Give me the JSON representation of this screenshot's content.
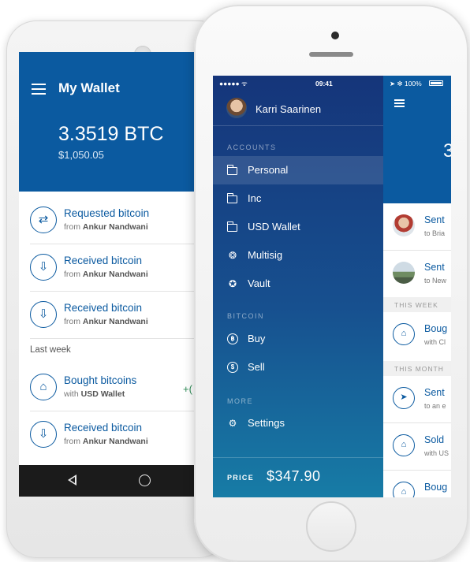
{
  "android": {
    "header": {
      "title": "My Wallet",
      "balance_btc": "3.3519 BTC",
      "balance_usd": "$1,050.05"
    },
    "transactions": [
      {
        "title": "Requested bitcoin",
        "prefix": "from",
        "party": "Ankur Nandwani",
        "icon": "exchange-arrows-icon",
        "glyph": "⇄"
      },
      {
        "title": "Received bitcoin",
        "prefix": "from",
        "party": "Ankur Nandwani",
        "icon": "receive-icon",
        "glyph": "⇩"
      },
      {
        "title": "Received bitcoin",
        "prefix": "from",
        "party": "Ankur Nandwani",
        "icon": "receive-icon",
        "glyph": "⇩"
      }
    ],
    "section_last_week": "Last week",
    "last_week": [
      {
        "title": "Bought bitcoins",
        "prefix": "with",
        "party": "USD Wallet",
        "amount": "+(",
        "icon": "bank-icon",
        "glyph": "⌂"
      },
      {
        "title": "Received bitcoin",
        "prefix": "from",
        "party": "Ankur Nandwani",
        "icon": "receive-icon",
        "glyph": "⇩"
      }
    ]
  },
  "iphone": {
    "status": {
      "carrier": "●●●●● ᯤ",
      "time": "09:41",
      "right": "➤ ✻ 100%"
    },
    "user": {
      "name": "Karri Saarinen"
    },
    "accounts_label": "ACCOUNTS",
    "accounts": [
      {
        "label": "Personal",
        "selected": true
      },
      {
        "label": "Inc",
        "selected": false
      },
      {
        "label": "USD Wallet",
        "selected": false
      },
      {
        "label": "Multisig",
        "selected": false,
        "icon": "multisig-icon",
        "glyph": "❂"
      },
      {
        "label": "Vault",
        "selected": false,
        "icon": "vault-icon",
        "glyph": "✪"
      }
    ],
    "bitcoin_label": "BITCOIN",
    "bitcoin_items": [
      {
        "label": "Buy",
        "glyph": "฿"
      },
      {
        "label": "Sell",
        "glyph": "$"
      }
    ],
    "more_label": "MORE",
    "settings_label": "Settings",
    "price_label": "PRICE",
    "price_value": "$347.90",
    "peek": {
      "balance_partial": "3",
      "rows": [
        {
          "title": "Sent",
          "sub": "to Bria"
        },
        {
          "title": "Sent",
          "sub": "to New"
        }
      ],
      "this_week": "THIS WEEK",
      "week_rows": [
        {
          "title": "Boug",
          "sub": "with Cl",
          "glyph": "⌂"
        }
      ],
      "this_month": "THIS MONTH",
      "month_rows": [
        {
          "title": "Sent",
          "sub": "to an e",
          "glyph": "➤"
        },
        {
          "title": "Sold",
          "sub": "with US",
          "glyph": "⌂"
        },
        {
          "title": "Boug",
          "sub": "",
          "glyph": "⌂"
        }
      ]
    }
  }
}
